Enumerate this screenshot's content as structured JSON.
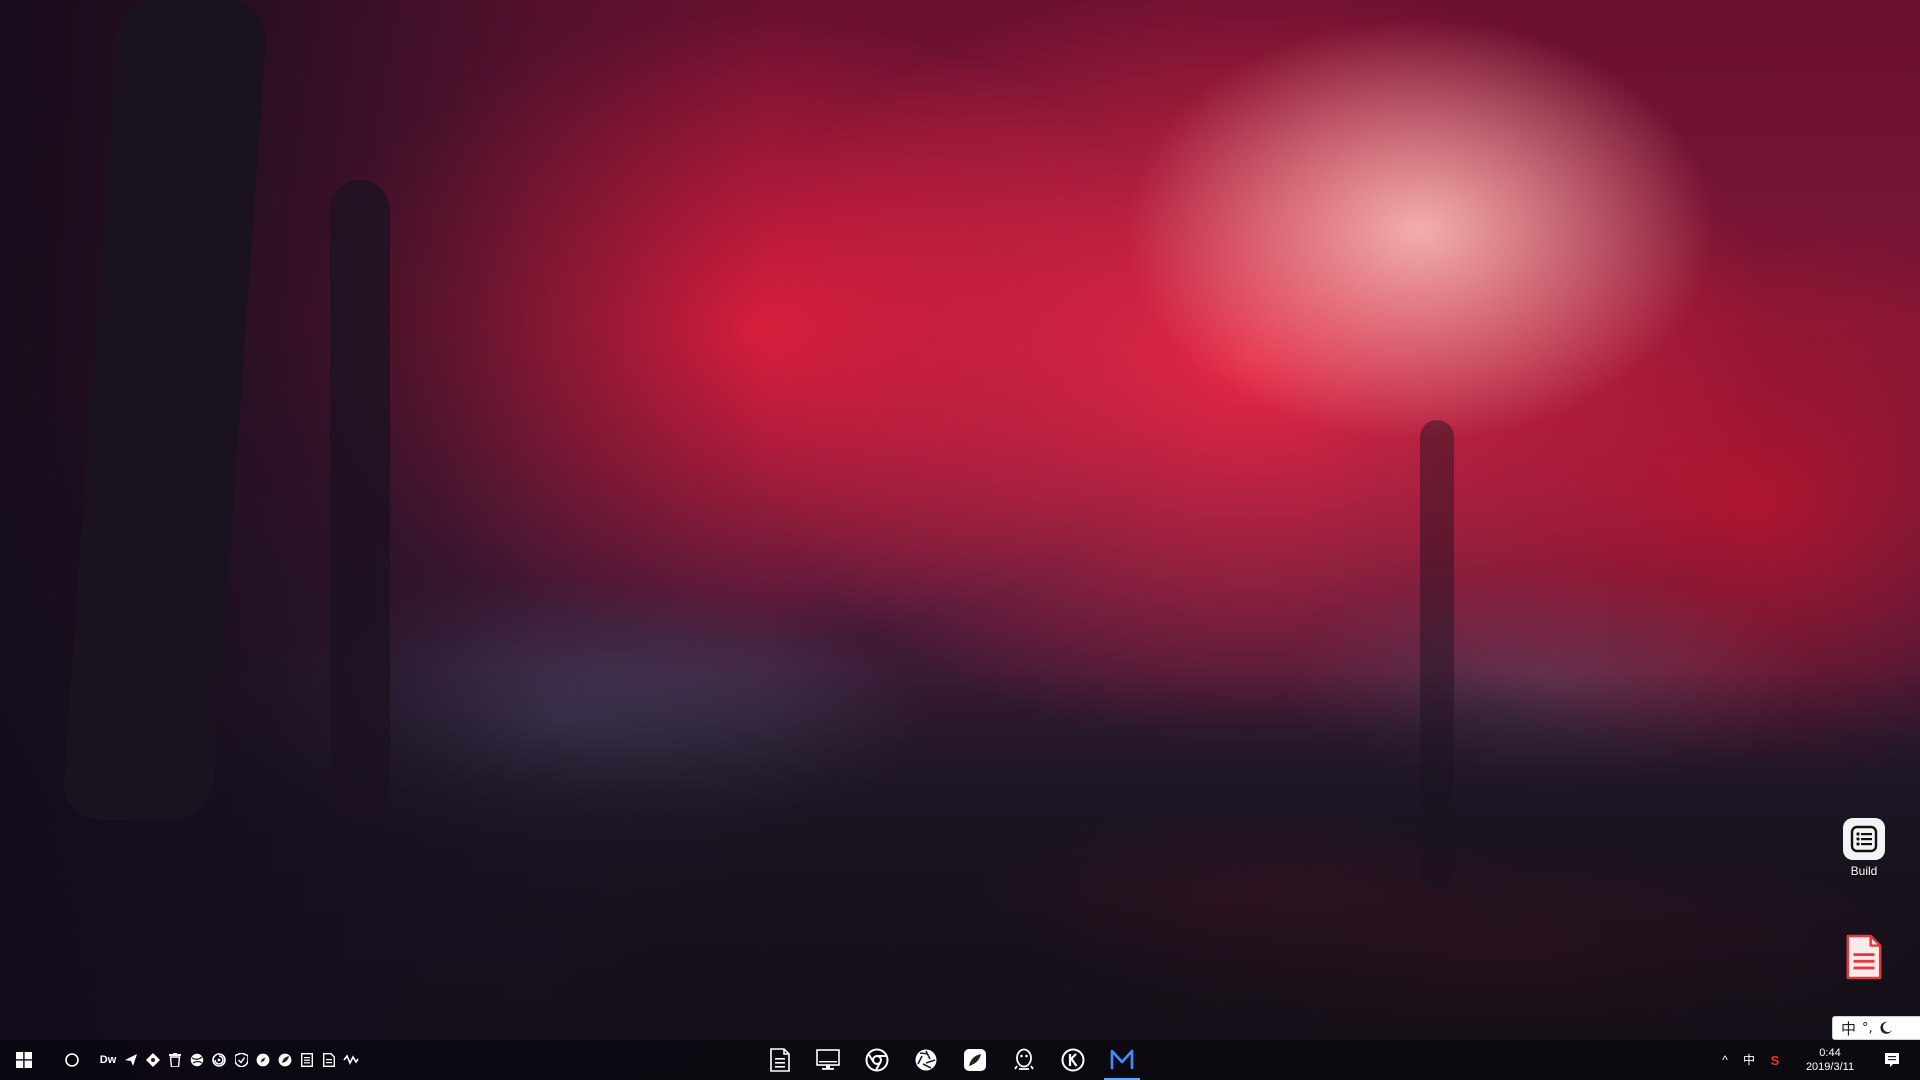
{
  "desktop": {
    "icons": [
      {
        "label": "Build",
        "icon": "list-document-icon"
      },
      {
        "label": "",
        "icon": "text-document-icon"
      }
    ]
  },
  "ime": {
    "mode": "中",
    "punct": "°,",
    "icon": "moon-icon"
  },
  "taskbar": {
    "start_icon": "windows-logo-icon",
    "search_icon": "cortana-circle-icon",
    "quick_launch": [
      {
        "name": "dreamweaver",
        "text": "Dw"
      },
      {
        "name": "paper-plane-icon"
      },
      {
        "name": "puzzle-icon"
      },
      {
        "name": "trash-icon"
      },
      {
        "name": "globe-icon"
      },
      {
        "name": "swirl-icon"
      },
      {
        "name": "shield-icon"
      },
      {
        "name": "compass-icon"
      },
      {
        "name": "leaf-icon"
      },
      {
        "name": "notes-icon"
      },
      {
        "name": "document-icon"
      },
      {
        "name": "wave-icon"
      }
    ],
    "apps": [
      {
        "name": "notepad-icon"
      },
      {
        "name": "monitor-icon"
      },
      {
        "name": "chrome-icon"
      },
      {
        "name": "aperture-icon"
      },
      {
        "name": "feather-app-icon"
      },
      {
        "name": "qq-penguin-icon"
      },
      {
        "name": "k-circle-icon"
      },
      {
        "name": "m-app-icon",
        "active": true
      }
    ],
    "tray": {
      "chevron": "^",
      "ime": "中",
      "sogou": "S",
      "time": "0:44",
      "date": "2019/3/11",
      "notification_icon": "action-center-icon"
    }
  },
  "colors": {
    "accent": "#62a8ff",
    "taskbar_bg": "#0c0810",
    "sogou": "#e8322e"
  }
}
